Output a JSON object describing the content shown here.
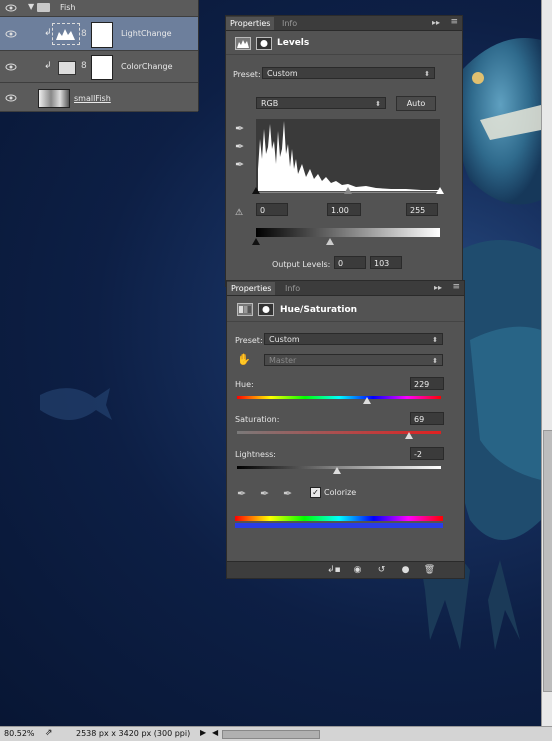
{
  "layers": {
    "group_name": "Fish",
    "items": [
      {
        "name": "LightChange"
      },
      {
        "name": "ColorChange"
      },
      {
        "name": "smallFish"
      }
    ]
  },
  "levels_panel": {
    "tabs": [
      "Properties",
      "Info"
    ],
    "title": "Levels",
    "preset_label": "Preset:",
    "preset_value": "Custom",
    "channel_value": "RGB",
    "auto_label": "Auto",
    "input_black": "0",
    "input_gamma": "1.00",
    "input_white": "255",
    "output_label": "Output Levels:",
    "output_black": "0",
    "output_white": "103"
  },
  "hue_panel": {
    "tabs": [
      "Properties",
      "Info"
    ],
    "title": "Hue/Saturation",
    "preset_label": "Preset:",
    "preset_value": "Custom",
    "range_value": "Master",
    "hue_label": "Hue:",
    "hue_value": "229",
    "sat_label": "Saturation:",
    "sat_value": "69",
    "light_label": "Lightness:",
    "light_value": "-2",
    "colorize_label": "Colorize",
    "colorize_checked": true,
    "hue_level": 229,
    "sat_level": 69,
    "light_level": -2
  },
  "status": {
    "zoom": "80.52%",
    "doc_info": "2538 px x 3420 px (300 ppi)"
  },
  "colors": {
    "panel": "#535353",
    "selected_layer": "#6d7f9c",
    "canvas": "#0d1f45"
  }
}
